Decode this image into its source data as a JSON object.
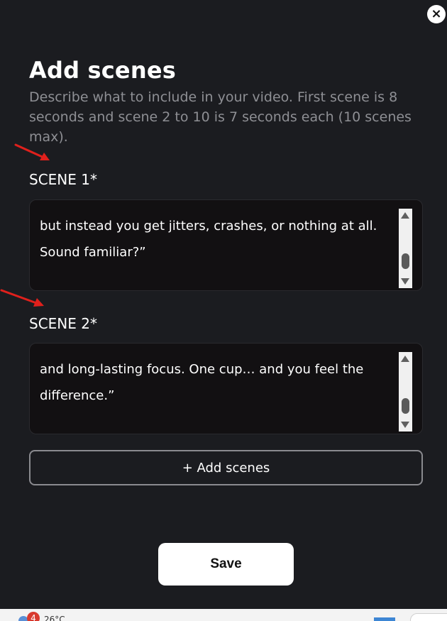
{
  "modal": {
    "title": "Add scenes",
    "subtitle": "Describe what to include in your video. First scene is 8 seconds and scene 2 to 10 is 7 seconds each (10 scenes max).",
    "close_icon": "×",
    "scenes": [
      {
        "label": "SCENE 1*",
        "text": "but instead you get jitters, crashes, or nothing at all. Sound familiar?”",
        "scroll_position": 0.75
      },
      {
        "label": "SCENE 2*",
        "text": "and long-lasting focus. One cup… and you feel the difference.”",
        "scroll_position": 0.85
      }
    ],
    "add_scenes_label": "+ Add scenes",
    "save_label": "Save"
  },
  "annotation_color": "#e0201c",
  "taskbar": {
    "weather_badge": "4",
    "weather_temp": "26°C"
  }
}
